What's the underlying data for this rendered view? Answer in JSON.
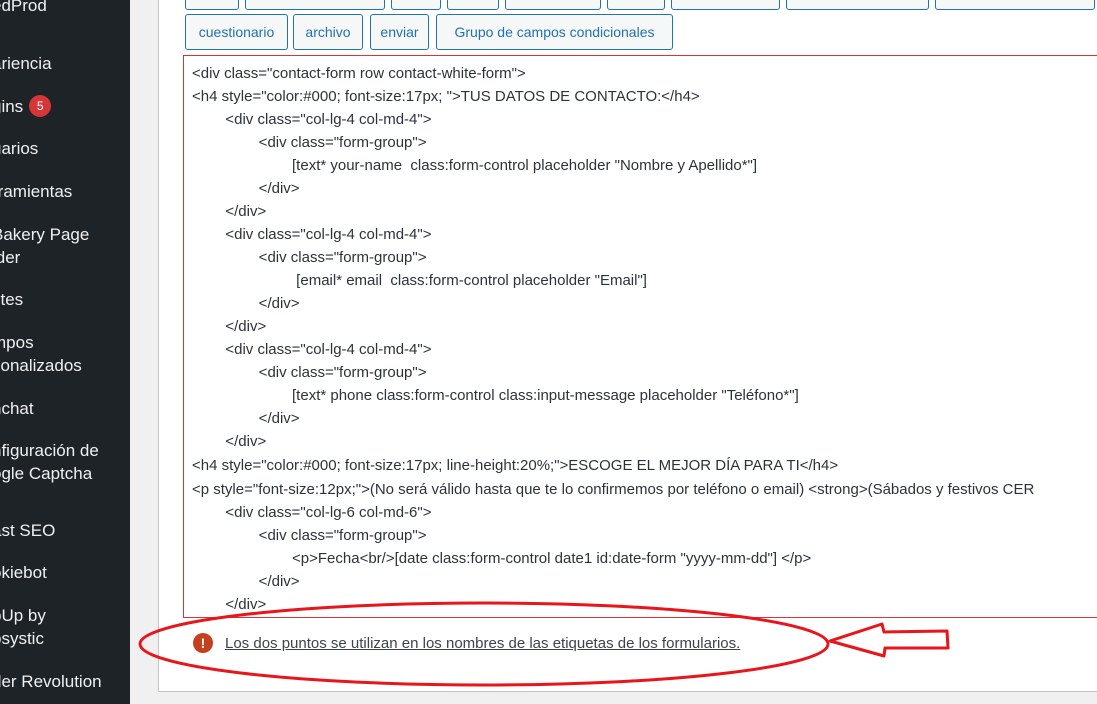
{
  "sidebar": {
    "items": [
      {
        "label": "edProd"
      },
      {
        "label": "ariencia"
      },
      {
        "label": "gins",
        "badge": "5"
      },
      {
        "label": "uarios"
      },
      {
        "label": "rramientas"
      },
      {
        "label": "Bakery Page",
        "label2": "lder"
      },
      {
        "label": "stes"
      },
      {
        "label": "mpos",
        "label2": "sonalizados"
      },
      {
        "label": "nchat"
      },
      {
        "label": "nfiguración de",
        "label2": "ogle Captcha"
      },
      {
        "label": "ast SEO"
      },
      {
        "label": "okiebot"
      },
      {
        "label": "pUp by",
        "label2": "psystic"
      },
      {
        "label": "der Revolution"
      }
    ]
  },
  "toolbar": {
    "buttons": [
      {
        "label": "cuestionario"
      },
      {
        "label": "archivo"
      },
      {
        "label": "enviar"
      },
      {
        "label": "Grupo de campos condicionales"
      }
    ]
  },
  "editor": {
    "lines": [
      "<div class=\"contact-form row contact-white-form\">",
      "<h4 style=\"color:#000; font-size:17px; \">TUS DATOS DE CONTACTO:</h4>",
      "        <div class=\"col-lg-4 col-md-4\">",
      "                <div class=\"form-group\">",
      "                        [text* your-name  class:form-control placeholder \"Nombre y Apellido*\"]",
      "                </div>",
      "        </div>",
      "        <div class=\"col-lg-4 col-md-4\">",
      "                <div class=\"form-group\">",
      "                         [email* email  class:form-control placeholder \"Email\"]",
      "                </div>",
      "        </div>",
      "        <div class=\"col-lg-4 col-md-4\">",
      "                <div class=\"form-group\">",
      "                        [text* phone class:form-control class:input-message placeholder \"Teléfono*\"]",
      "                </div>",
      "        </div>",
      "<h4 style=\"color:#000; font-size:17px; line-height:20%;\">ESCOGE EL MEJOR DÍA PARA TI</h4>",
      "<p style=\"font-size:12px;\">(No será válido hasta que te lo confirmemos por teléfono o email) <strong>(Sábados y festivos CER",
      "        <div class=\"col-lg-6 col-md-6\">",
      "                <div class=\"form-group\">",
      "                        <p>Fecha<br/>[date class:form-control date1 id:date-form \"yyyy-mm-dd\"] </p>",
      "                </div>",
      "        </div>"
    ]
  },
  "warning": {
    "icon": "!",
    "text": "Los dos puntos se utilizan en los nombres de las etiquetas de los formularios."
  },
  "colors": {
    "sidebar_bg": "#1d2327",
    "button_border": "#2271b1",
    "error_red": "#d63638",
    "annotation_red": "#e8151b"
  }
}
